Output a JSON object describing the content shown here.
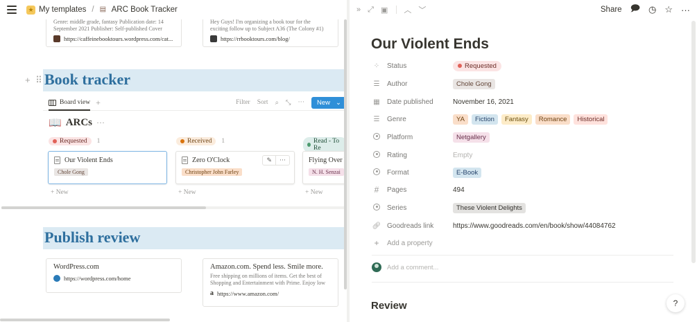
{
  "breadcrumb": {
    "workspace": "My templates",
    "separator": "/",
    "page": "ARC Book Tracker"
  },
  "bookmarks_top": [
    {
      "desc_line1": "Genre: middle grade, fantasy Publication date: 14",
      "desc_line2": "September 2021 Publisher: Self-published Cover",
      "url": "https://caffeinebooktours.wordpress.com/cat..."
    },
    {
      "desc_line1": "Hey Guys! I'm organizing a book tour for the",
      "desc_line2": "exciting follow up to Subject A36 (The Colony #1)",
      "url": "https://rrbooktours.com/blog/"
    }
  ],
  "book_tracker": {
    "heading": "Book tracker",
    "view_tab": "Board view",
    "add_view": "+",
    "filter": "Filter",
    "sort": "Sort",
    "more": "···",
    "new_button": "New",
    "db_icon": "📖",
    "db_title": "ARCs",
    "db_more": "···",
    "columns": [
      {
        "label": "Requested",
        "count": "1",
        "card_title": "Our Violent Ends",
        "card_tag": "Chole Gong",
        "new_label": "+ New"
      },
      {
        "label": "Received",
        "count": "1",
        "card_title": "Zero O'Clock",
        "card_tag": "Christopher John Farley",
        "new_label": "+ New"
      },
      {
        "label": "Read - To Re",
        "count": "",
        "card_title": "Flying Over W",
        "card_tag": "N. H. Senzai",
        "new_label": "+ New"
      }
    ],
    "card_action_edit": "✎",
    "card_action_more": "···"
  },
  "publish_review": {
    "heading": "Publish review",
    "bookmarks": [
      {
        "title": "WordPress.com",
        "desc_line1": "",
        "desc_line2": "",
        "url": "https://wordpress.com/home"
      },
      {
        "title": "Amazon.com. Spend less. Smile more.",
        "desc_line1": "Free shipping on millions of items. Get the best of",
        "desc_line2": "Shopping and Entertainment with Prime. Enjoy low",
        "url": "https://www.amazon.com/"
      }
    ]
  },
  "peek": {
    "toolbar": {
      "share": "Share"
    },
    "title": "Our Violent Ends",
    "properties": {
      "status": {
        "name": "Status",
        "value": "Requested"
      },
      "author": {
        "name": "Author",
        "value": "Chole Gong"
      },
      "date": {
        "name": "Date published",
        "value": "November 16, 2021"
      },
      "genre": {
        "name": "Genre",
        "values": [
          "YA",
          "Fiction",
          "Fantasy",
          "Romance",
          "Historical"
        ]
      },
      "platform": {
        "name": "Platform",
        "value": "Netgallery"
      },
      "rating": {
        "name": "Rating",
        "value": "Empty"
      },
      "format": {
        "name": "Format",
        "value": "E-Book"
      },
      "pages": {
        "name": "Pages",
        "value": "494"
      },
      "series": {
        "name": "Series",
        "value": "These Violent Delights"
      },
      "goodreads": {
        "name": "Goodreads link",
        "value": "https://www.goodreads.com/en/book/show/44084762"
      }
    },
    "add_property": "Add a property",
    "comment_placeholder": "Add a comment...",
    "review_heading": "Review",
    "help": "?"
  },
  "colors": {
    "heading_blue": "#2e6f9e",
    "heading_band": "#dbeaf3",
    "new_button": "#2f8fd8",
    "requested_bg": "#fbe4e4",
    "requested_dot": "#e16259",
    "received_bg": "#fbecdd",
    "received_dot": "#d9730d",
    "read_bg": "#ddedea",
    "read_dot": "#4d9a6f"
  }
}
